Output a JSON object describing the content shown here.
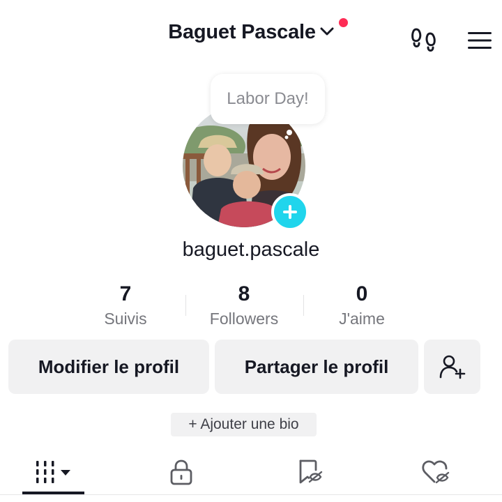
{
  "header": {
    "title": "Baguet Pascale",
    "has_notification_dot": true,
    "footprints_icon": "footprints-icon",
    "menu_icon": "hamburger-menu-icon"
  },
  "profile": {
    "bubble_text": "Labor Day!",
    "avatar_description": "family-selfie-photo",
    "username": "baguet.pascale"
  },
  "stats": [
    {
      "count": "7",
      "label": "Suivis"
    },
    {
      "count": "8",
      "label": "Followers"
    },
    {
      "count": "0",
      "label": "J'aime"
    }
  ],
  "actions": {
    "edit_profile": "Modifier le profil",
    "share_profile": "Partager le profil",
    "add_friend_icon": "add-friend-icon"
  },
  "bio_button": "+ Ajouter une bio",
  "tabs": [
    "videos-grid-icon",
    "lock-icon",
    "bookmark-icon",
    "liked-heart-icon"
  ],
  "colors": {
    "accent_red": "#fe2c55",
    "plus_cyan": "#20d5ec",
    "button_gray": "#f1f1f2",
    "text_primary": "#161823",
    "text_secondary": "#75767c"
  }
}
